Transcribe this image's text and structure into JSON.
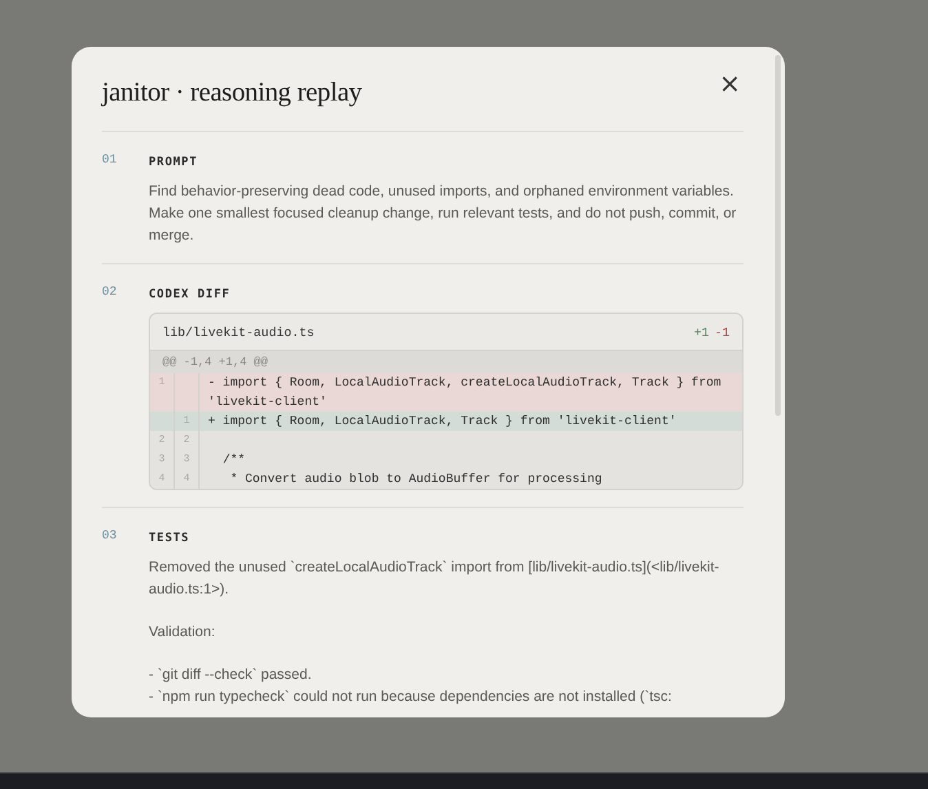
{
  "dialog": {
    "title": "janitor · reasoning replay",
    "close": "×"
  },
  "sections": [
    {
      "number": "01",
      "heading": "PROMPT",
      "kind": "text",
      "paragraphs": [
        [
          "Find behavior-preserving dead code, unused imports, and orphaned environment variables. Make one smallest focused cleanup change, run relevant tests, and do not push, commit, or merge."
        ]
      ]
    },
    {
      "number": "02",
      "heading": "CODEX DIFF",
      "kind": "diff",
      "diff": {
        "file": "lib/livekit-audio.ts",
        "added": "+1",
        "removed": "-1",
        "hunk": "@@ -1,4 +1,4 @@",
        "lines": [
          {
            "kind": "del",
            "old": "1",
            "text": "- import { Room, LocalAudioTrack, createLocalAudioTrack, Track } from 'livekit-client'"
          },
          {
            "kind": "add",
            "new": "1",
            "text": "+ import { Room, LocalAudioTrack, Track } from 'livekit-client'"
          },
          {
            "kind": "context",
            "old": "2",
            "new": "2"
          },
          {
            "kind": "context",
            "old": "3",
            "new": "3",
            "text": "  /**"
          },
          {
            "kind": "context",
            "old": "4",
            "new": "4",
            "text": "   * Convert audio blob to AudioBuffer for processing"
          }
        ]
      }
    },
    {
      "number": "03",
      "heading": "TESTS",
      "kind": "text",
      "paragraphs": [
        [
          "Removed the unused `createLocalAudioTrack` import from [lib/livekit-audio.ts](<lib/livekit-audio.ts:1>)."
        ],
        [
          "Validation:"
        ],
        [
          "- `git diff --check` passed.",
          "- `npm run typecheck` could not run because dependencies are not installed (`tsc:"
        ]
      ]
    }
  ]
}
